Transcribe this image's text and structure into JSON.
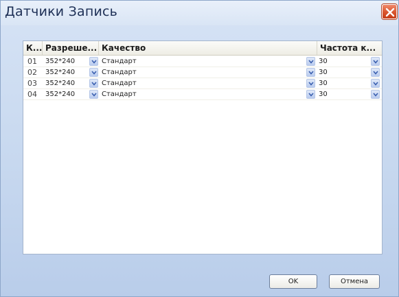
{
  "window": {
    "title": "Датчики Запись"
  },
  "grid": {
    "columns": [
      "К...",
      "Разреше...",
      "Качество",
      "Частота к..."
    ],
    "rows": [
      {
        "num": "01",
        "resolution": "352*240",
        "quality": "Стандарт",
        "rate": "30"
      },
      {
        "num": "02",
        "resolution": "352*240",
        "quality": "Стандарт",
        "rate": "30"
      },
      {
        "num": "03",
        "resolution": "352*240",
        "quality": "Стандарт",
        "rate": "30"
      },
      {
        "num": "04",
        "resolution": "352*240",
        "quality": "Стандарт",
        "rate": "30"
      }
    ]
  },
  "buttons": {
    "ok": "OK",
    "cancel": "Отмена"
  },
  "icons": {
    "close": "close-icon",
    "dropdown": "chevron-down-icon"
  },
  "colors": {
    "close_button": "#d9542c",
    "window_bg": "#c7d8ef",
    "grid_border": "#a3b4cc"
  }
}
